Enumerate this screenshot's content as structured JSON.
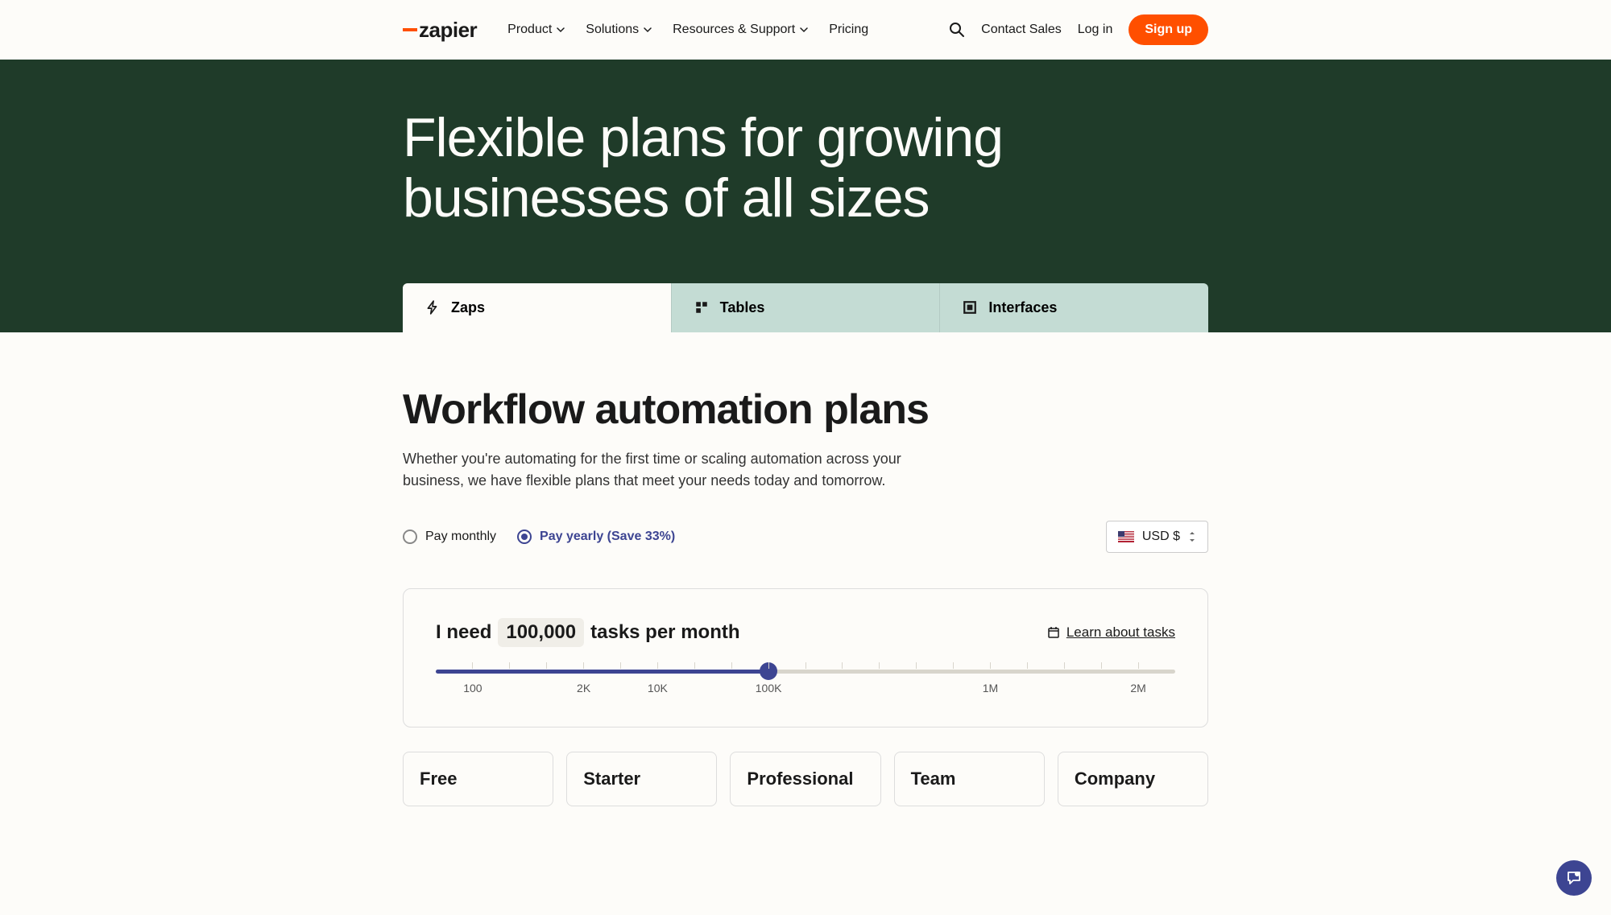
{
  "header": {
    "logo_text": "zapier",
    "nav": [
      {
        "label": "Product",
        "has_dropdown": true
      },
      {
        "label": "Solutions",
        "has_dropdown": true
      },
      {
        "label": "Resources & Support",
        "has_dropdown": true
      },
      {
        "label": "Pricing",
        "has_dropdown": false
      }
    ],
    "contact_sales": "Contact Sales",
    "login": "Log in",
    "signup": "Sign up"
  },
  "hero": {
    "title": "Flexible plans for growing businesses of all sizes"
  },
  "tabs": [
    {
      "label": "Zaps",
      "active": true
    },
    {
      "label": "Tables",
      "active": false
    },
    {
      "label": "Interfaces",
      "active": false
    }
  ],
  "section": {
    "title": "Workflow automation plans",
    "description": "Whether you're automating for the first time or scaling automation across your business, we have flexible plans that meet your needs today and tomorrow."
  },
  "billing": {
    "monthly_label": "Pay monthly",
    "yearly_label": "Pay yearly (Save 33%)",
    "selected": "yearly"
  },
  "currency": {
    "label": "USD $"
  },
  "slider": {
    "prefix": "I need",
    "count": "100,000",
    "suffix": "tasks per month",
    "learn_link": "Learn about tasks",
    "fill_percent": 45,
    "tick_labels": [
      {
        "text": "100",
        "pos": 5
      },
      {
        "text": "2K",
        "pos": 20
      },
      {
        "text": "10K",
        "pos": 30
      },
      {
        "text": "100K",
        "pos": 45
      },
      {
        "text": "1M",
        "pos": 75
      },
      {
        "text": "2M",
        "pos": 95
      }
    ]
  },
  "plans": [
    {
      "title": "Free"
    },
    {
      "title": "Starter"
    },
    {
      "title": "Professional"
    },
    {
      "title": "Team"
    },
    {
      "title": "Company"
    }
  ]
}
